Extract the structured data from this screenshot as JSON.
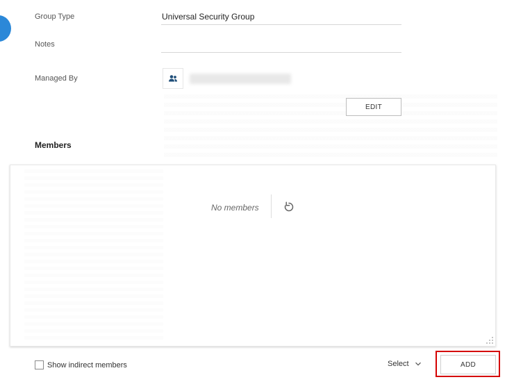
{
  "form": {
    "group_type_label": "Group Type",
    "group_type_value": "Universal Security Group",
    "notes_label": "Notes",
    "notes_value": "",
    "managed_by_label": "Managed By",
    "managed_by_icon": "people-icon",
    "edit_label": "EDIT"
  },
  "members": {
    "heading": "Members",
    "empty_text": "No members",
    "refresh_icon": "refresh-icon"
  },
  "footer": {
    "show_indirect_label": "Show indirect members",
    "show_indirect_checked": false,
    "select_label": "Select",
    "add_label": "ADD"
  },
  "colors": {
    "accent": "#2b88d8",
    "highlight": "#d40000"
  }
}
